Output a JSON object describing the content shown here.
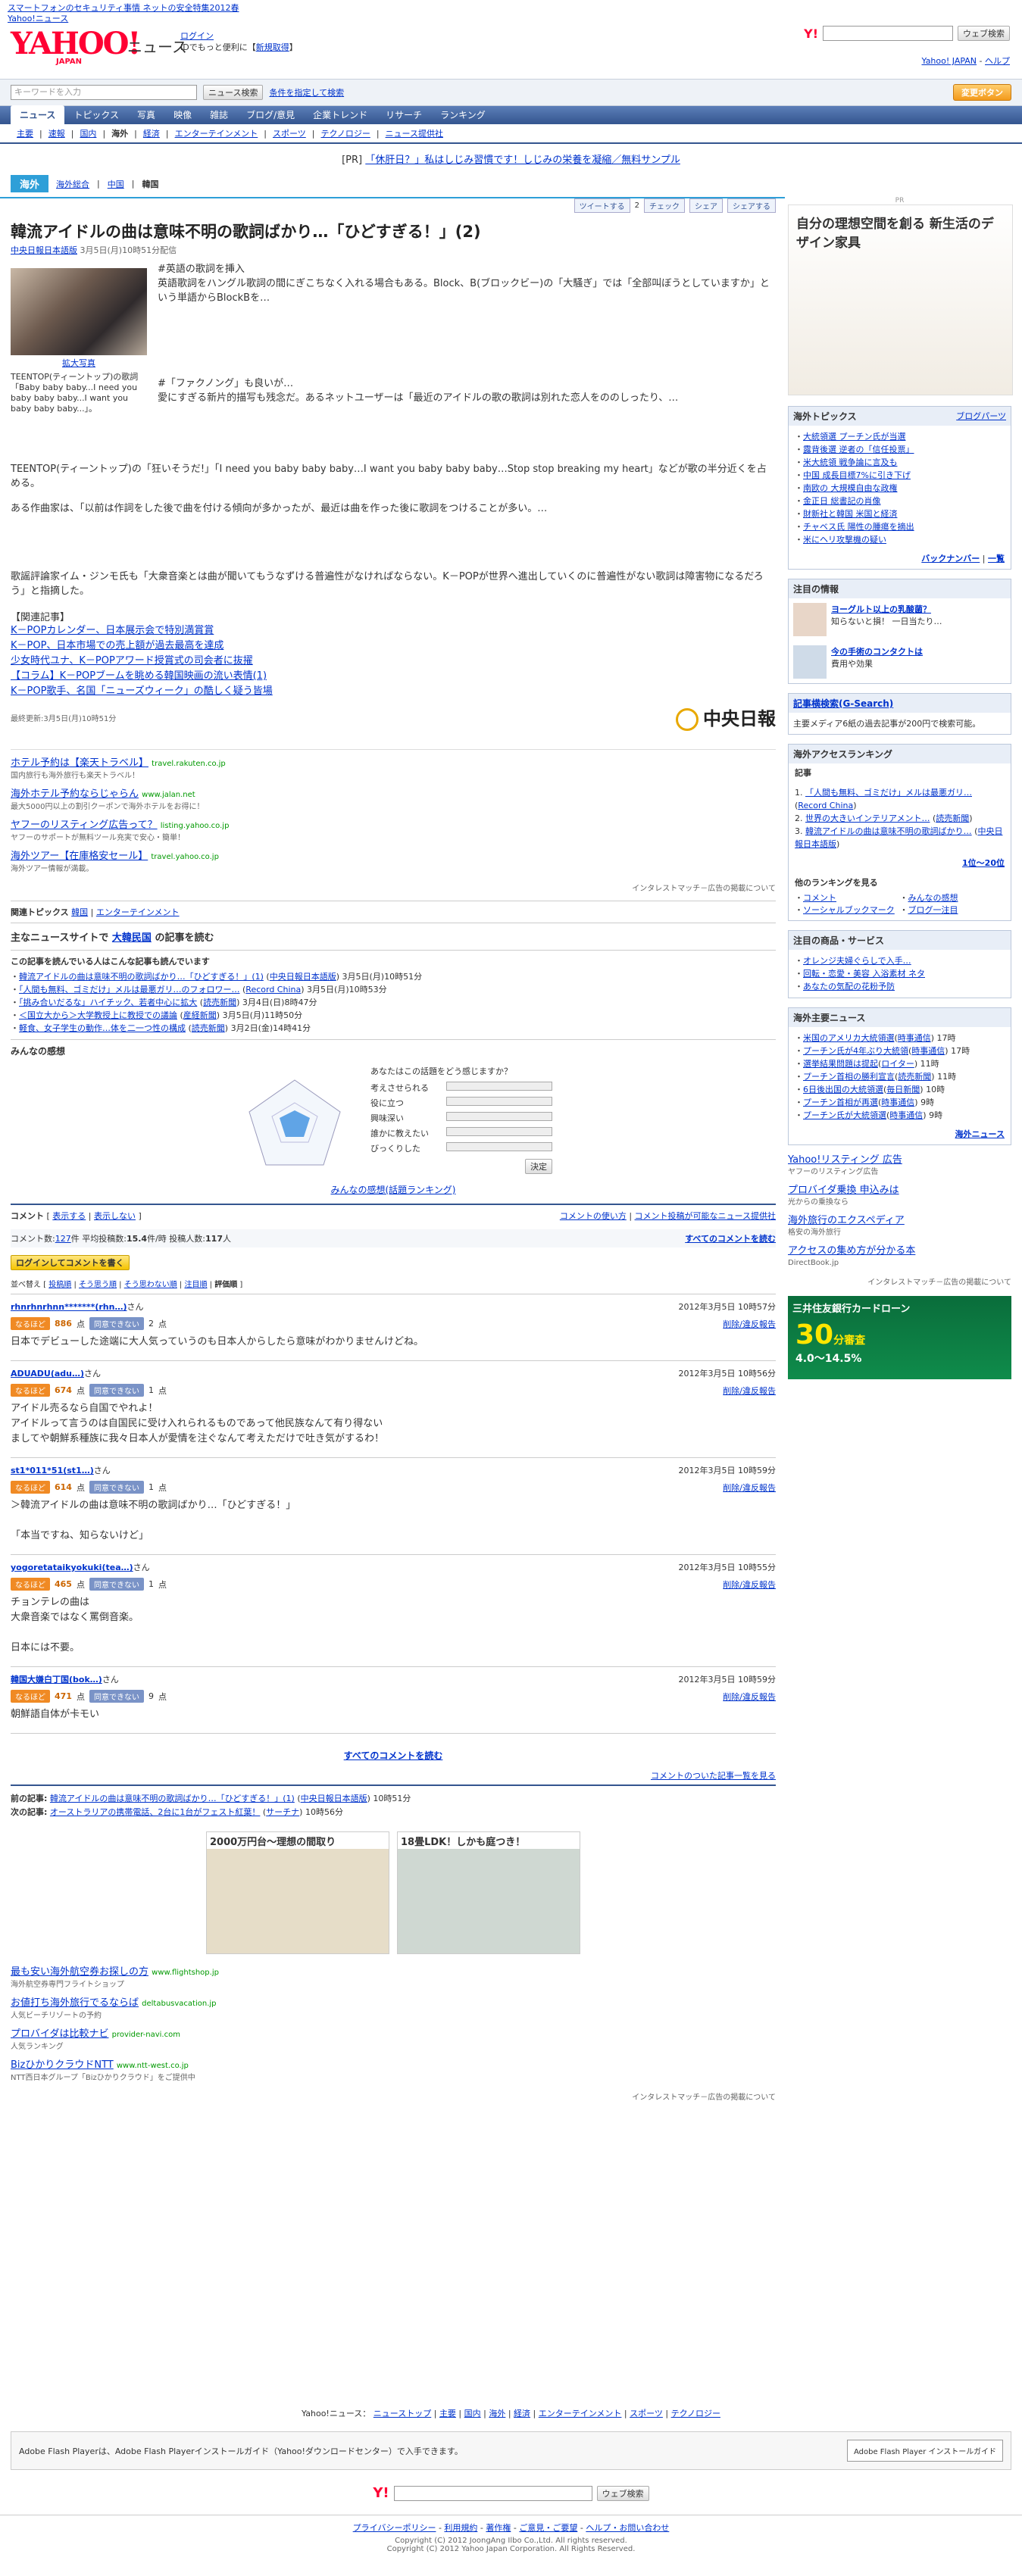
{
  "top_promo": [
    "スマートフォンのセキュリティ事情 ネットの安全特集2012春",
    "Yahoo!ニュース"
  ],
  "header": {
    "logo_text": "YAHOO!",
    "logo_sub": "JAPAN",
    "section": "ニュース",
    "login": "ログイン",
    "login_hint": "IDでもっと便利に",
    "register": "新規取得",
    "web_search": "ウェブ検索",
    "yahoo_japan": "Yahoo! JAPAN",
    "help": "ヘルプ"
  },
  "searchbar": {
    "placeholder": "キーワードを入力",
    "news_search": "ニュース検索",
    "cond_search": "条件を指定して検索",
    "change_btn": "変更ボタン"
  },
  "nav1": [
    "ニュース",
    "トピックス",
    "写真",
    "映像",
    "雑誌",
    "ブログ/意見",
    "企業トレンド",
    "リサーチ",
    "ランキング"
  ],
  "nav2": [
    "主要",
    "速報",
    "国内",
    "海外",
    "経済",
    "エンターテインメント",
    "スポーツ",
    "テクノロジー",
    "ニュース提供社"
  ],
  "pr_line": {
    "prefix": "[PR]",
    "link": "「休肝日？」私はしじみ習慣です！しじみの栄養を凝縮／無料サンプル"
  },
  "section": {
    "title": "海外",
    "tabs": [
      "海外総合",
      "中国",
      "韓国"
    ]
  },
  "share": {
    "tweet": "ツイートする",
    "tweet_count": "2",
    "check": "チェック",
    "facebook": "シェア",
    "share": "シェアする"
  },
  "article": {
    "title": "韓流アイドルの曲は意味不明の歌詞ばかり…「ひどすぎる！」(2)",
    "source": "中央日報日本語版",
    "date": "3月5日(月)10時51分配信",
    "photo_caption_link": "拡大写真",
    "photo_caption": "TEENTOP(ティーントップ)の歌詞「Baby baby baby...I need you baby baby baby...I want you baby baby baby...」。",
    "paragraphs": [
      "#英語の歌詞を挿入",
      "英語歌詞をハングル歌詞の間にぎこちなく入れる場合もある。Block、B(ブロックビー)の「大騒ぎ」では「全部叫ぼうとしていますか」という単語からBlockBを…",
      "#「ファクノング」も良いが…",
      "愛にすぎる新片的描写も残念だ。あるネットユーザーは「最近のアイドルの歌の歌詞は別れた恋人をののしったり、…",
      "TEENTOP(ティーントップ)の「狂いそうだ!」「I need you baby baby baby…I want you baby baby baby…Stop stop breaking my heart」などが歌の半分近くを占める。",
      "ある作曲家は、「以前は作詞をした後で曲を付ける傾向が多かったが、最近は曲を作った後に歌詞をつけることが多い。…",
      "歌謡評論家イム・ジンモ氏も「大衆音楽とは曲が聞いてもうなずける普遍性がなければならない。K－POPが世界へ進出していくのに普遍性がない歌詞は障害物になるだろう」と指摘した。"
    ],
    "related_title": "【関連記事】",
    "related": [
      "K－POPカレンダー、日本展示会で特別満賞賞",
      "K－POP、日本市場での売上額が過去最高を達成",
      "少女時代ユナ、K－POPアワード授賞式の司会者に抜擢",
      "【コラム】K－POPブームを眺める韓国映画の流い表情(1)",
      "K－POP歌手、名国「ニューズウィーク」の酷しく疑う皆場"
    ],
    "updated": "最終更新:3月5日(月)10時51分",
    "provider_logo": "中央日報"
  },
  "listing_ads": [
    {
      "title": "ホテル予約は【楽天トラベル】",
      "url": "travel.rakuten.co.jp",
      "desc": "国内旅行も海外旅行も楽天トラベル！"
    },
    {
      "title": "海外ホテル予約ならじゃらん",
      "url": "www.jalan.net",
      "desc": "最大5000円以上の割引クーポンで海外ホテルをお得に！"
    },
    {
      "title": "ヤフーのリスティング広告って？",
      "url": "listing.yahoo.co.jp",
      "desc": "ヤフーのサポートが無料ツール充実で安心・簡単！"
    },
    {
      "title": "海外ツアー【在庫格安セール】",
      "url": "travel.yahoo.co.jp",
      "desc": "海外ツアー情報が満載。"
    }
  ],
  "listing_footer": "インタレストマッチ－広告の掲載について",
  "topics_bar": {
    "label": "関連トピックス",
    "items": [
      "韓国",
      "エンターテインメント"
    ]
  },
  "major_news": {
    "prefix": "主なニュースサイトで",
    "link": "大韓民国",
    "suffix": "の記事を読む"
  },
  "also_read": {
    "title": "この記事を読んでいる人はこんな記事も読んでいます",
    "items": [
      {
        "title": "韓流アイドルの曲は意味不明の歌詞ばかり…「ひどすぎる！」(1)",
        "src": "中央日報日本語版",
        "time": "3月5日(月)10時51分"
      },
      {
        "title": "「人間も無料、ゴミだけ」メルは最悪ガリ…のフォロワー…",
        "src": "Record China",
        "time": "3月5日(月)10時53分"
      },
      {
        "title": "「挑み合いだるな」ハイチック、若者中心に拡大",
        "src": "読売新聞",
        "time": "3月4日(日)8時47分"
      },
      {
        "title": "＜国立大から＞大学教授上に教授での議論",
        "src": "産経新聞",
        "time": "3月5日(月)11時50分"
      },
      {
        "title": "軽食、女子学生の動作…体を二一つ性の構成",
        "src": "読売新聞",
        "time": "3月2日(金)14時41分"
      }
    ]
  },
  "impressions": {
    "title": "みんなの感想",
    "question": "あなたはこの話題をどう感じますか？",
    "labels": [
      "考えさせられる",
      "役に立つ",
      "興味深い",
      "誰かに教えたい",
      "びっくりした"
    ],
    "submit": "決定",
    "ranking": "みんなの感想(話題ランキング)"
  },
  "comments": {
    "title": "コメント",
    "view_toggle": "表示する",
    "hide_toggle": "表示しない",
    "info_link": "コメントの使い方",
    "provider_link": "コメント投稿が可能なニュース提供社",
    "count": "127",
    "count_label": "コメント数:",
    "avg_label": "平均投稿数:",
    "avg": "15.4",
    "avg_unit": "件/時",
    "posters_label": "投稿人数:",
    "posters": "117",
    "all_link": "すべてのコメントを読む",
    "login_btn": "ログインしてコメントを書く",
    "sort": [
      "投稿順",
      "そう思う順",
      "そう思わない順",
      "注目順",
      "評価順"
    ],
    "agree": "なるほど",
    "disagree": "同意できない",
    "delete": "削除/違反報告",
    "items": [
      {
        "user": "rhnrhnrhnn*******(rhn…)",
        "time": "2012年3月5日 10時57分",
        "agree": "886",
        "disagree": "2",
        "text": "日本でデビューした途端に大人気っていうのも日本人からしたら意味がわかりませんけどね。"
      },
      {
        "user": "ADUADU(adu…)",
        "time": "2012年3月5日 10時56分",
        "agree": "674",
        "disagree": "1",
        "text": "アイドル売るなら自国でやれよ！\nアイドルって言うのは自国民に受け入れられるものであって他民族なんて有り得ない\nましてや朝鮮系種族に我々日本人が愛情を注ぐなんて考えただけで吐き気がするわ！"
      },
      {
        "user": "st1*011*51(st1…)",
        "time": "2012年3月5日 10時59分",
        "agree": "614",
        "disagree": "1",
        "text": "＞韓流アイドルの曲は意味不明の歌詞ばかり…「ひどすぎる！」\n\n「本当ですね、知らないけど」"
      },
      {
        "user": "yogoretataikyokuki(tea…)",
        "time": "2012年3月5日 10時55分",
        "agree": "465",
        "disagree": "1",
        "text": "チョンテレの曲は\n大衆音楽ではなく罵倒音楽。\n\n日本には不要。"
      },
      {
        "user": "韓国大嫌白丁国(bok…)",
        "time": "2012年3月5日 10時59分",
        "agree": "471",
        "disagree": "9",
        "text": "朝鮮語自体が卡モい"
      }
    ],
    "read_all": "すべてのコメントを読む",
    "ranking_link": "コメントのついた記事一覧を見る"
  },
  "prevnext": {
    "prev_label": "前の記事:",
    "prev": "韓流アイドルの曲は意味不明の歌詞ばかり…「ひどすぎる！」(1)",
    "prev_src": "中央日報日本語版",
    "prev_time": "10時51分",
    "next_label": "次の記事:",
    "next": "オーストラリアの携帯電話、2台に1台がフェスト紅葉！",
    "next_src": "サーチナ",
    "next_time": "10時56分"
  },
  "banner_ads": [
    {
      "title": "2000万円台～理想の間取り"
    },
    {
      "title": "18畳LDK！しかも庭つき！"
    }
  ],
  "bottom_ads": [
    {
      "title": "最も安い海外航空券お探しの方",
      "url": "www.flightshop.jp",
      "desc": "海外航空券専門フライトショップ"
    },
    {
      "title": "お値打ち海外旅行でるならば",
      "url": "deltabusvacation.jp",
      "desc": "人気ビーチリゾートの予約"
    },
    {
      "title": "プロバイダは比較ナビ",
      "url": "provider-navi.com",
      "desc": "人気ランキング"
    },
    {
      "title": "BizひかりクラウドNTT",
      "url": "www.ntt-west.co.jp",
      "desc": "NTT西日本グループ「Bizひかりクラウド」をご提供中"
    }
  ],
  "bottom_listing_footer": "インタレストマッチ－広告の掲載について",
  "footer_links": [
    "ニューストップ",
    "主要",
    "国内",
    "海外",
    "経済",
    "エンターテインメント",
    "スポーツ",
    "テクノロジー"
  ],
  "flash_note": "Adobe Flash Playerは、Adobe Flash Playerインストールガイド（Yahoo!ダウンロードセンター）で入手できます。",
  "flash_badge": "Adobe Flash Player インストールガイド",
  "footer_nav": [
    "プライバシーポリシー",
    "利用規約",
    "著作権",
    "ご意見・ご要望",
    "ヘルプ・お問い合わせ"
  ],
  "copyright1": "Copyright (C) 2012 JoongAng Ilbo Co.,Ltd. All rights reserved.",
  "copyright2": "Copyright (C) 2012 Yahoo Japan Corporation. All Rights Reserved.",
  "sidebar": {
    "pr_label": "PR",
    "ad_title": "自分の理想空間を創る 新生活のデザイン家具",
    "topics_title": "海外トピックス",
    "topics_more": "ブログパーツ",
    "topics": [
      "大統領選 プーチン氏が当選",
      "露背後選 逆者の「信任投票」",
      "米大統領 戦争論に言及も",
      "中国 成長目標7%に引き下げ",
      "南欧の 大規模自由な政権",
      "金正日 総書記の肖像",
      "財新社と韓国 米国と経済",
      "チャベス氏 陽性の腫瘍を摘出",
      "米にヘリ攻撃機の疑い"
    ],
    "topics_more2": "バックナンバー",
    "topics_list": "一覧",
    "info_title": "注目の情報",
    "info": [
      {
        "title": "ヨーグルト以上の乳酸菌？",
        "desc": "知らないと損！ 一日当たり…"
      },
      {
        "title": "今の手術のコンタクトは",
        "desc": "費用や効果"
      }
    ],
    "search_title": "記事横検索(G-Search)",
    "search_desc": "主要メディア6紙の過去記事が200円で検索可能。",
    "access_title": "海外アクセスランキング",
    "access_tab": "記事",
    "access": [
      {
        "title": "「人間も無料、ゴミだけ」メルは最悪ガリ…",
        "src": "Record China"
      },
      {
        "title": "世界の大きいインテリアメント…",
        "src": "読売新聞"
      },
      {
        "title": "韓流アイドルの曲は意味不明の歌詞ばかり…",
        "src": "中央日報日本語版"
      }
    ],
    "access_more": "1位～20位",
    "other_title": "他のランキングを見る",
    "other": [
      "コメント",
      "みんなの感想",
      "ソーシャルブックマーク",
      "ブログ一注目"
    ],
    "products_title": "注目の商品・サービス",
    "products": [
      "オレンジ夫婦ぐらしで入手…",
      "回転・恋愛・美容 入浴素材 ネタ",
      "あなたの気配の花粉予防"
    ],
    "news_title": "海外主要ニュース",
    "news": [
      {
        "title": "米国のアメリカ大統領選",
        "src": "時事通信",
        "time": "17時"
      },
      {
        "title": "プーチン氏が4年ぶり大統領",
        "src": "時事通信",
        "time": "17時"
      },
      {
        "title": "選挙結果問題は提起",
        "src": "ロイター",
        "time": "11時"
      },
      {
        "title": "プーチン首相の勝利宣言",
        "src": "読売新聞",
        "time": "11時"
      },
      {
        "title": "6日後出国の大統領選",
        "src": "毎日新聞",
        "time": "10時"
      },
      {
        "title": "プーチン首相が再選",
        "src": "時事通信",
        "time": "9時"
      },
      {
        "title": "プーチン氏が大統領選",
        "src": "時事通信",
        "time": "9時"
      }
    ],
    "news_more": "海外ニュース",
    "ad2": [
      {
        "title": "Yahoo!リスティング 広告",
        "desc": "ヤフーのリスティング広告"
      },
      {
        "title": "プロバイダ乗換 申込みは",
        "desc": "光からの乗換なら"
      },
      {
        "title": "海外旅行のエクスペディア",
        "desc": "格安の海外旅行"
      },
      {
        "title": "アクセスの集め方が分かる本",
        "desc": "DirectBook.jp"
      }
    ],
    "ad2_footer": "インタレストマッチ－広告の掲載について",
    "loan_title": "三井住友銀行カードローン",
    "loan_days": "30",
    "loan_rate": "4.0～14.5"
  }
}
